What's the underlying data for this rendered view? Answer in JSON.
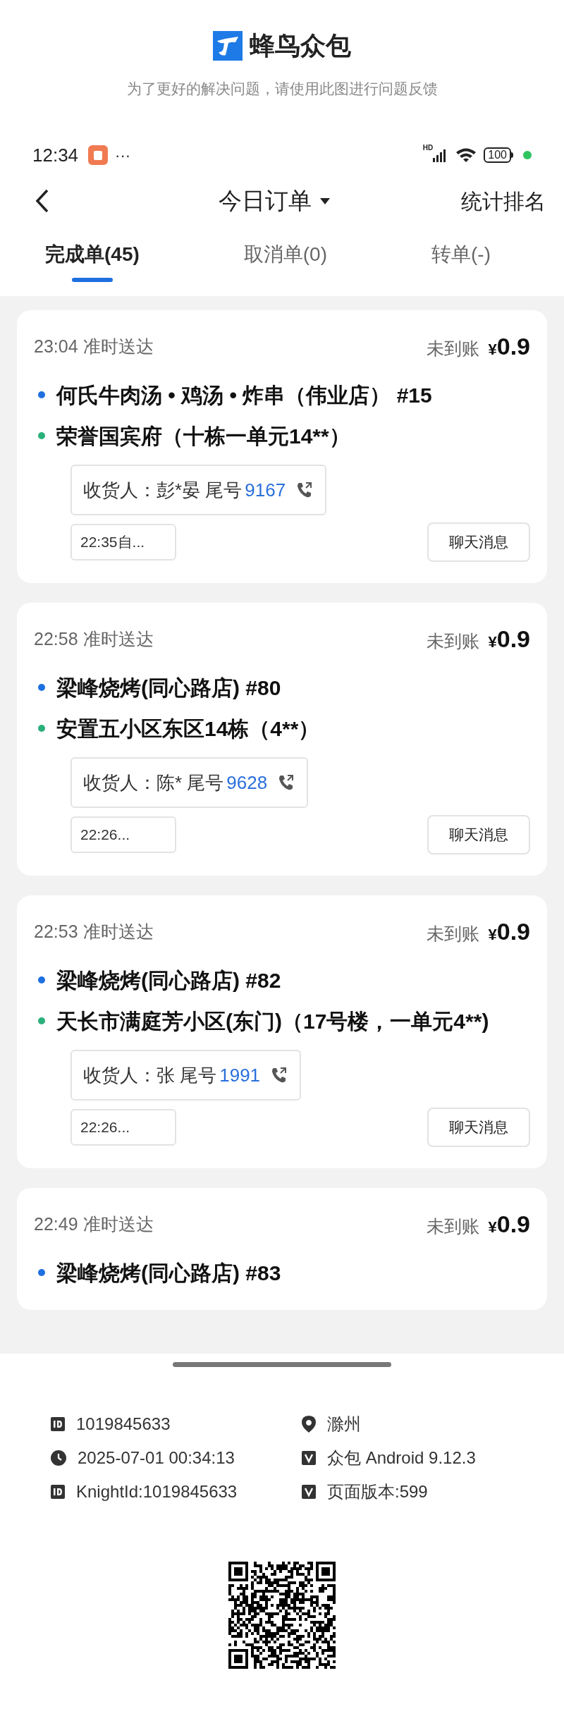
{
  "header": {
    "app_name": "蜂鸟众包",
    "subtitle": "为了更好的解决问题，请使用此图进行问题反馈"
  },
  "status_bar": {
    "time": "12:34",
    "more": "···",
    "network": "HD",
    "battery": "100"
  },
  "nav": {
    "title": "今日订单",
    "right_action": "统计排名"
  },
  "tabs": [
    {
      "label": "完成单(45)",
      "selected": true
    },
    {
      "label": "取消单(0)",
      "selected": false
    },
    {
      "label": "转单(-)",
      "selected": false
    }
  ],
  "orders": [
    {
      "time": "23:04",
      "status": "准时送达",
      "settlement": "未到账",
      "currency": "¥",
      "amount": "0.9",
      "store": "何氏牛肉汤 • 鸡汤 • 炸串（伟业店） #15",
      "address": "荣誉国宾府（十栋一单元14**）",
      "receiver": "收货人：彭*晏 尾号",
      "tail_number": "9167",
      "note": "22:35自...",
      "chat_button": "聊天消息"
    },
    {
      "time": "22:58",
      "status": "准时送达",
      "settlement": "未到账",
      "currency": "¥",
      "amount": "0.9",
      "store": "梁峰烧烤(同心路店) #80",
      "address": "安置五小区东区14栋（4**）",
      "receiver": "收货人：陈* 尾号",
      "tail_number": "9628",
      "note": "22:26...",
      "chat_button": "聊天消息"
    },
    {
      "time": "22:53",
      "status": "准时送达",
      "settlement": "未到账",
      "currency": "¥",
      "amount": "0.9",
      "store": "梁峰烧烤(同心路店) #82",
      "address": "天长市满庭芳小区(东门)（17号楼，一单元4**)",
      "receiver": "收货人：张 尾号",
      "tail_number": "1991",
      "note": "22:26...",
      "chat_button": "聊天消息"
    },
    {
      "time": "22:49",
      "status": "准时送达",
      "settlement": "未到账",
      "currency": "¥",
      "amount": "0.9",
      "store": "梁峰烧烤(同心路店) #83"
    }
  ],
  "footer": {
    "info": [
      {
        "kind": "id",
        "text": "1019845633"
      },
      {
        "kind": "location",
        "text": "滁州"
      },
      {
        "kind": "clock",
        "text": "2025-07-01 00:34:13"
      },
      {
        "kind": "version",
        "text": "众包 Android 9.12.3"
      },
      {
        "kind": "id",
        "text": "KnightId:1019845633"
      },
      {
        "kind": "version",
        "text": "页面版本:599"
      }
    ]
  }
}
